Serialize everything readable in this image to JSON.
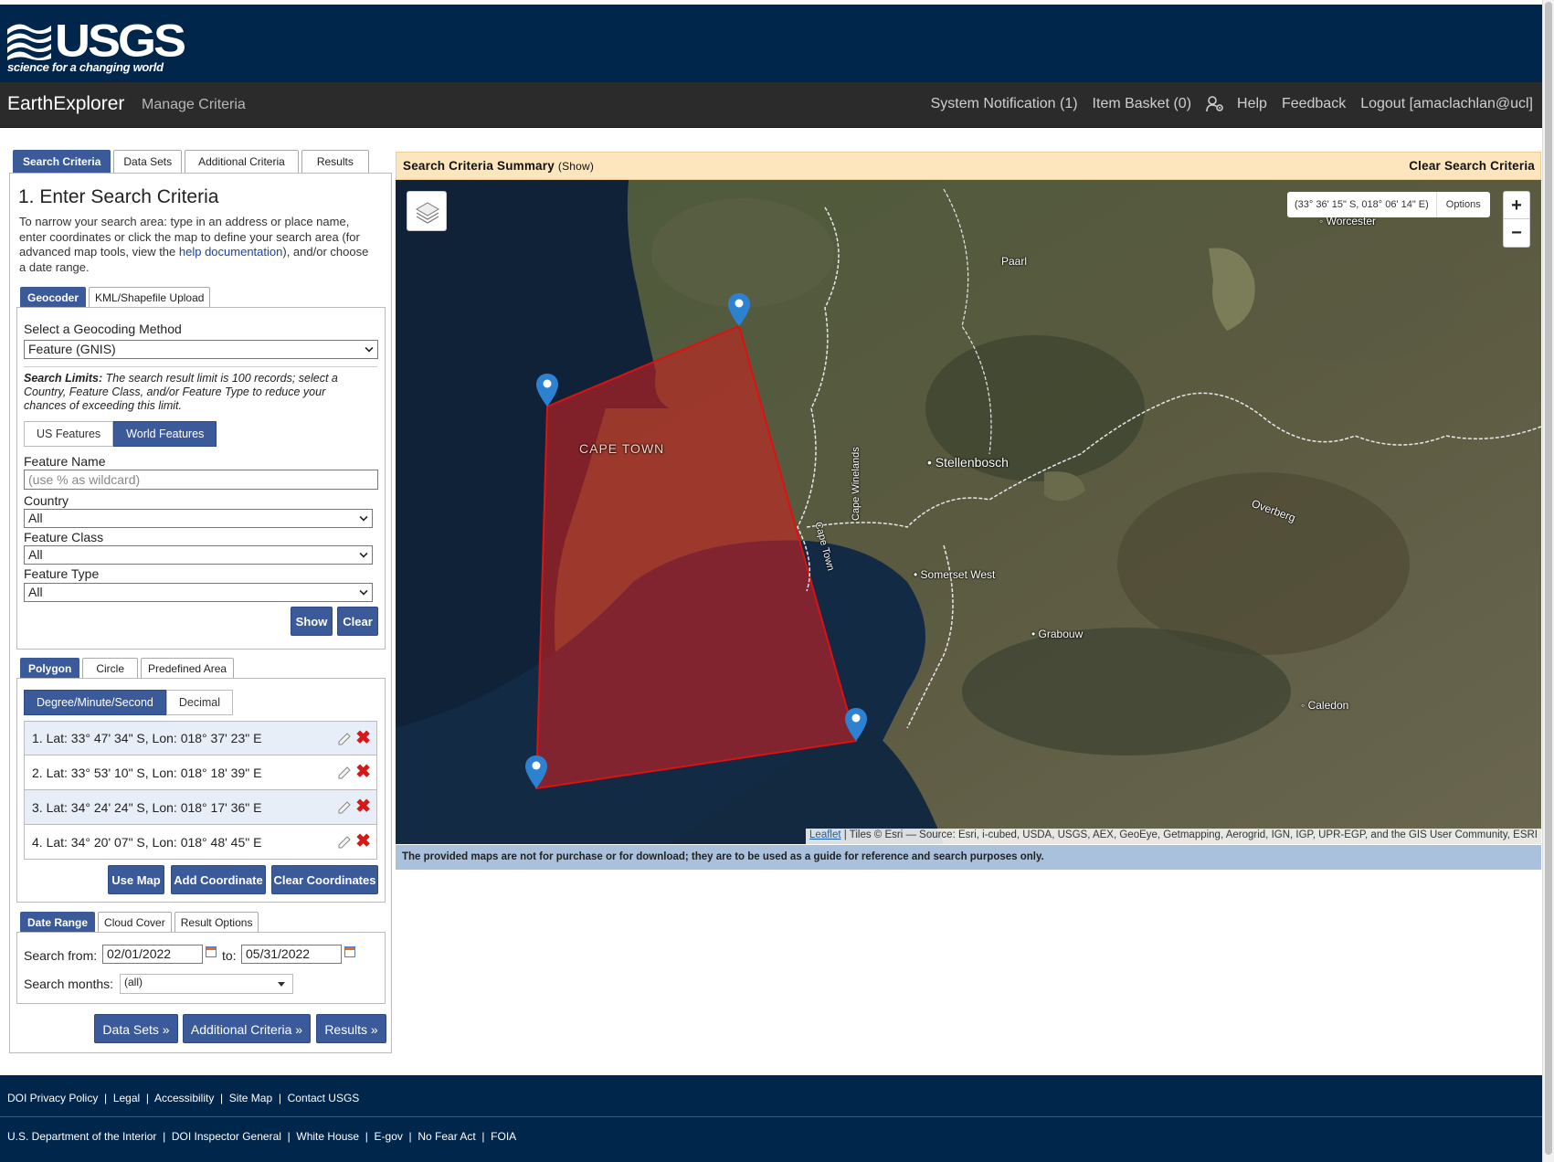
{
  "brand": {
    "word": "USGS",
    "tagline": "science for a changing world"
  },
  "topnav": {
    "app_title": "EarthExplorer",
    "manage": "Manage Criteria",
    "notification": "System Notification (1)",
    "basket": "Item Basket (0)",
    "help": "Help",
    "feedback": "Feedback",
    "logout": "Logout [amaclachlan@ucl]"
  },
  "main_tabs": [
    "Search Criteria",
    "Data Sets",
    "Additional Criteria",
    "Results"
  ],
  "search": {
    "title": "1. Enter Search Criteria",
    "intro_a": "To narrow your search area: type in an address or place name, enter coordinates or click the map to define your search area (for advanced map tools, view the ",
    "intro_link": "help documentation",
    "intro_b": "), and/or choose a date range."
  },
  "geocoder": {
    "tabs": [
      "Geocoder",
      "KML/Shapefile Upload"
    ],
    "method_label": "Select a Geocoding Method",
    "method_value": "Feature (GNIS)",
    "limits_bold": "Search Limits:",
    "limits_text": " The search result limit is 100 records; select a Country, Feature Class, and/or Feature Type to reduce your chances of exceeding this limit.",
    "toggle": [
      "US Features",
      "World Features"
    ],
    "feature_name_label": "Feature Name",
    "feature_name_placeholder": "(use % as wildcard)",
    "country_label": "Country",
    "country_value": "All",
    "class_label": "Feature Class",
    "class_value": "All",
    "type_label": "Feature Type",
    "type_value": "All",
    "show": "Show",
    "clear": "Clear"
  },
  "area": {
    "tabs": [
      "Polygon",
      "Circle",
      "Predefined Area"
    ],
    "format_toggle": [
      "Degree/Minute/Second",
      "Decimal"
    ],
    "coordinates": [
      "1.  Lat: 33° 47' 34\" S, Lon: 018° 37' 23\" E",
      "2.  Lat: 33° 53' 10\" S, Lon: 018° 18' 39\" E",
      "3.  Lat: 34° 24' 24\" S, Lon: 018° 17' 36\" E",
      "4.  Lat: 34° 20' 07\" S, Lon: 018° 48' 45\" E"
    ],
    "use_map": "Use Map",
    "add_coord": "Add Coordinate",
    "clear_coords": "Clear Coordinates"
  },
  "dates": {
    "tabs": [
      "Date Range",
      "Cloud Cover",
      "Result Options"
    ],
    "from_label": "Search from:",
    "from_value": "02/01/2022",
    "to_label": "to:",
    "to_value": "05/31/2022",
    "months_label": "Search months:",
    "months_value": "(all)"
  },
  "nav_buttons": [
    "Data Sets »",
    "Additional Criteria »",
    "Results »"
  ],
  "summary": {
    "title": "Search Criteria Summary",
    "show": "(Show)",
    "clear": "Clear Search Criteria"
  },
  "map": {
    "coord_readout": "(33° 36' 15\" S, 018° 06' 14\" E)",
    "options": "Options",
    "zoom_in": "+",
    "zoom_out": "−",
    "places": {
      "worcester": "Worcester",
      "paarl": "Paarl",
      "stellenbosch": "Stellenbosch",
      "somerset": "Somerset West",
      "grabouw": "Grabouw",
      "caledon": "Caledon",
      "overberg": "Overberg",
      "cape_town": "CAPE TOWN",
      "winelands": "Cape Winelands",
      "capetown_road": "Cape Town"
    },
    "attrib_link": "Leaflet",
    "attrib_text": " | Tiles © Esri — Source: Esri, i-cubed, USDA, USGS, AEX, GeoEye, Getmapping, Aerogrid, IGN, IGP, UPR-EGP, and the GIS User Community, ESRI",
    "disclaimer": "The provided maps are not for purchase or for download; they are to be used as a guide for reference and search purposes only.",
    "polygon_color": "#cc2222"
  },
  "footer": {
    "row1": [
      "DOI Privacy Policy",
      "Legal",
      "Accessibility",
      "Site Map",
      "Contact USGS"
    ],
    "row2": [
      "U.S. Department of the Interior",
      "DOI Inspector General",
      "White House",
      "E-gov",
      "No Fear Act",
      "FOIA"
    ]
  }
}
